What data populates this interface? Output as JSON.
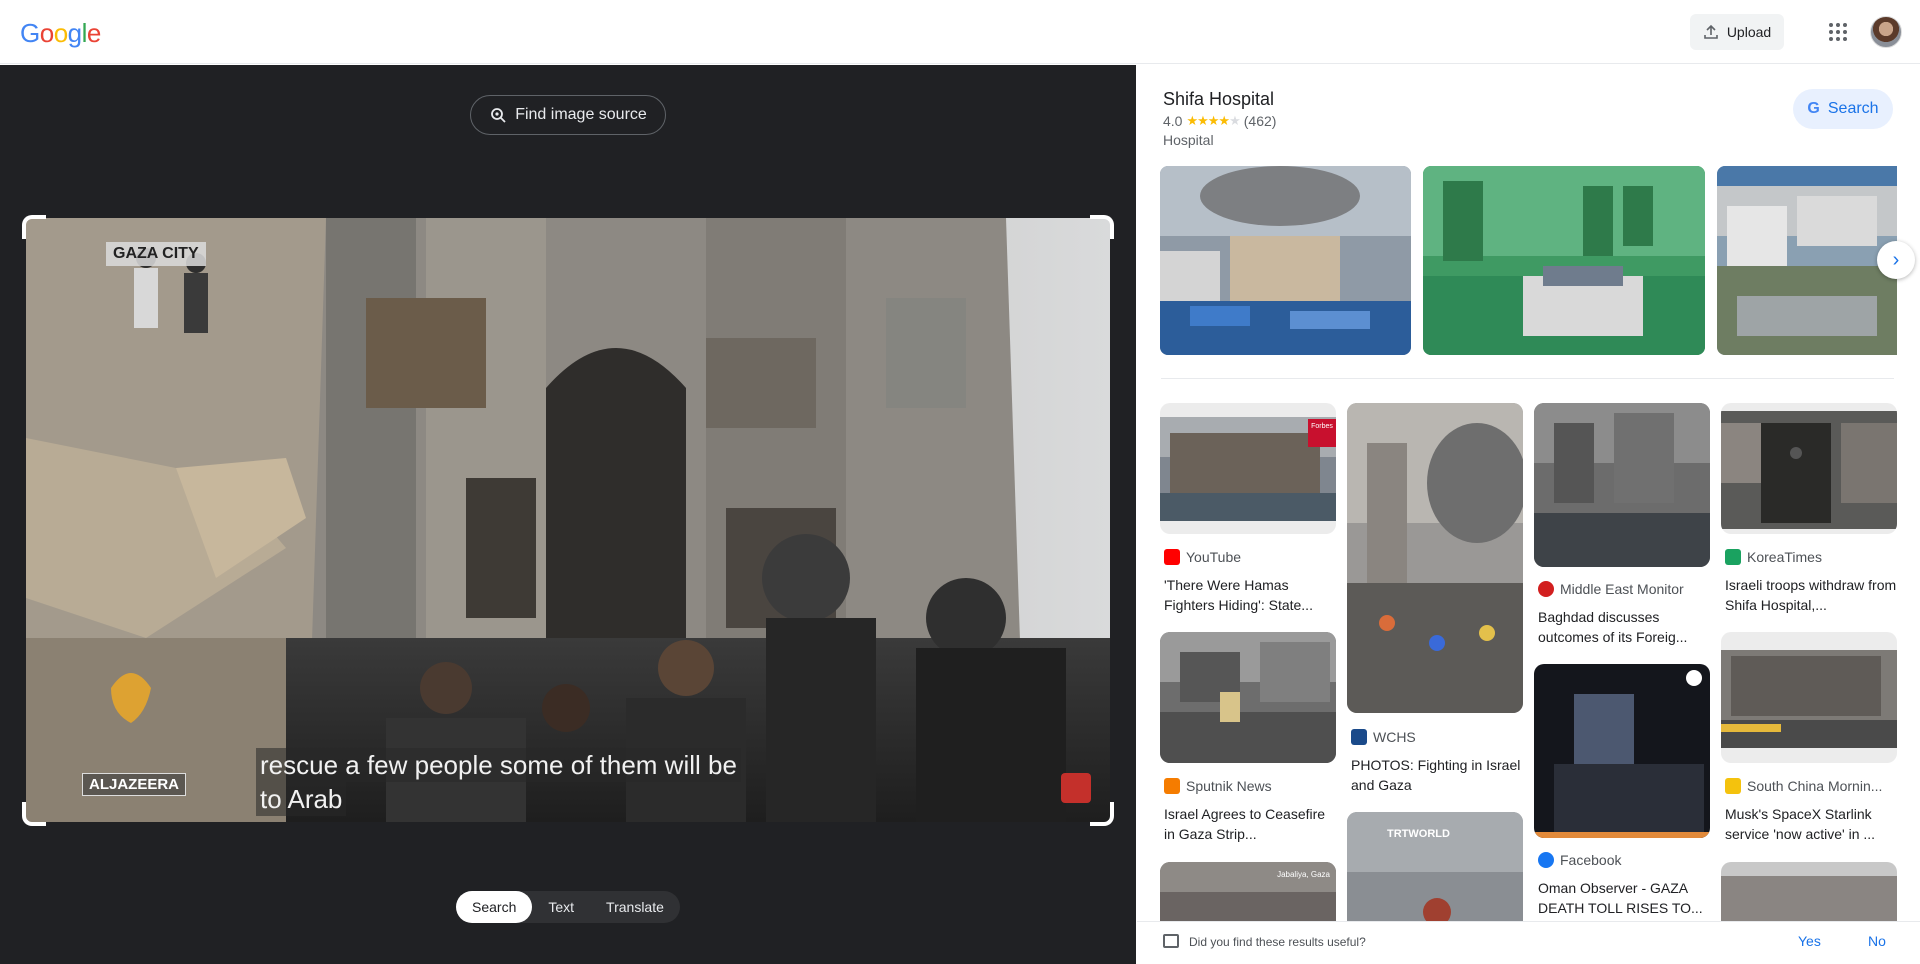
{
  "header": {
    "logo_text": "Google",
    "upload_label": "Upload",
    "apps_icon": "apps-grid-icon",
    "avatar_icon": "account-avatar"
  },
  "lens": {
    "find_source_label": "Find image source",
    "image_overlay": {
      "location_tag": "GAZA CITY",
      "brand": "ALJAZEERA",
      "caption_line1": "rescue a few people some of them will be",
      "caption_line2": "to Arab"
    },
    "modes": [
      "Search",
      "Text",
      "Translate"
    ],
    "active_mode": "Search"
  },
  "knowledge_panel": {
    "title": "Shifa Hospital",
    "rating": "4.0",
    "stars": 4,
    "review_count": "(462)",
    "type": "Hospital",
    "search_label": "Search"
  },
  "results": [
    {
      "source": "YouTube",
      "title": "'There Were Hamas Fighters Hiding': State...",
      "favicon_color": "#ff0000"
    },
    {
      "source": "WCHS",
      "title": "PHOTOS: Fighting in Israel and Gaza",
      "favicon_color": "#1a4a8a"
    },
    {
      "source": "Middle East Monitor",
      "title": "Baghdad discusses outcomes of its Foreig...",
      "favicon_color": "#d21f1f"
    },
    {
      "source": "KoreaTimes",
      "title": "Israeli troops withdraw from Shifa Hospital,...",
      "favicon_color": "#1aa260"
    },
    {
      "source": "Sputnik News",
      "title": "Israel Agrees to Ceasefire in Gaza Strip...",
      "favicon_color": "#f57c00"
    },
    {
      "source": "Facebook",
      "title": "Oman Observer - GAZA DEATH TOLL RISES TO...",
      "favicon_color": "#1877f2"
    },
    {
      "source": "South China Mornin...",
      "title": "Musk's SpaceX Starlink service 'now active' in ...",
      "favicon_color": "#f4c20d"
    }
  ],
  "thumb_labels": {
    "forbes": "Forbes",
    "trtworld": "TRTWORLD",
    "jabaliya": "Jabaliya, Gaza"
  },
  "feedback": {
    "question": "Did you find these results useful?",
    "yes": "Yes",
    "no": "No"
  }
}
